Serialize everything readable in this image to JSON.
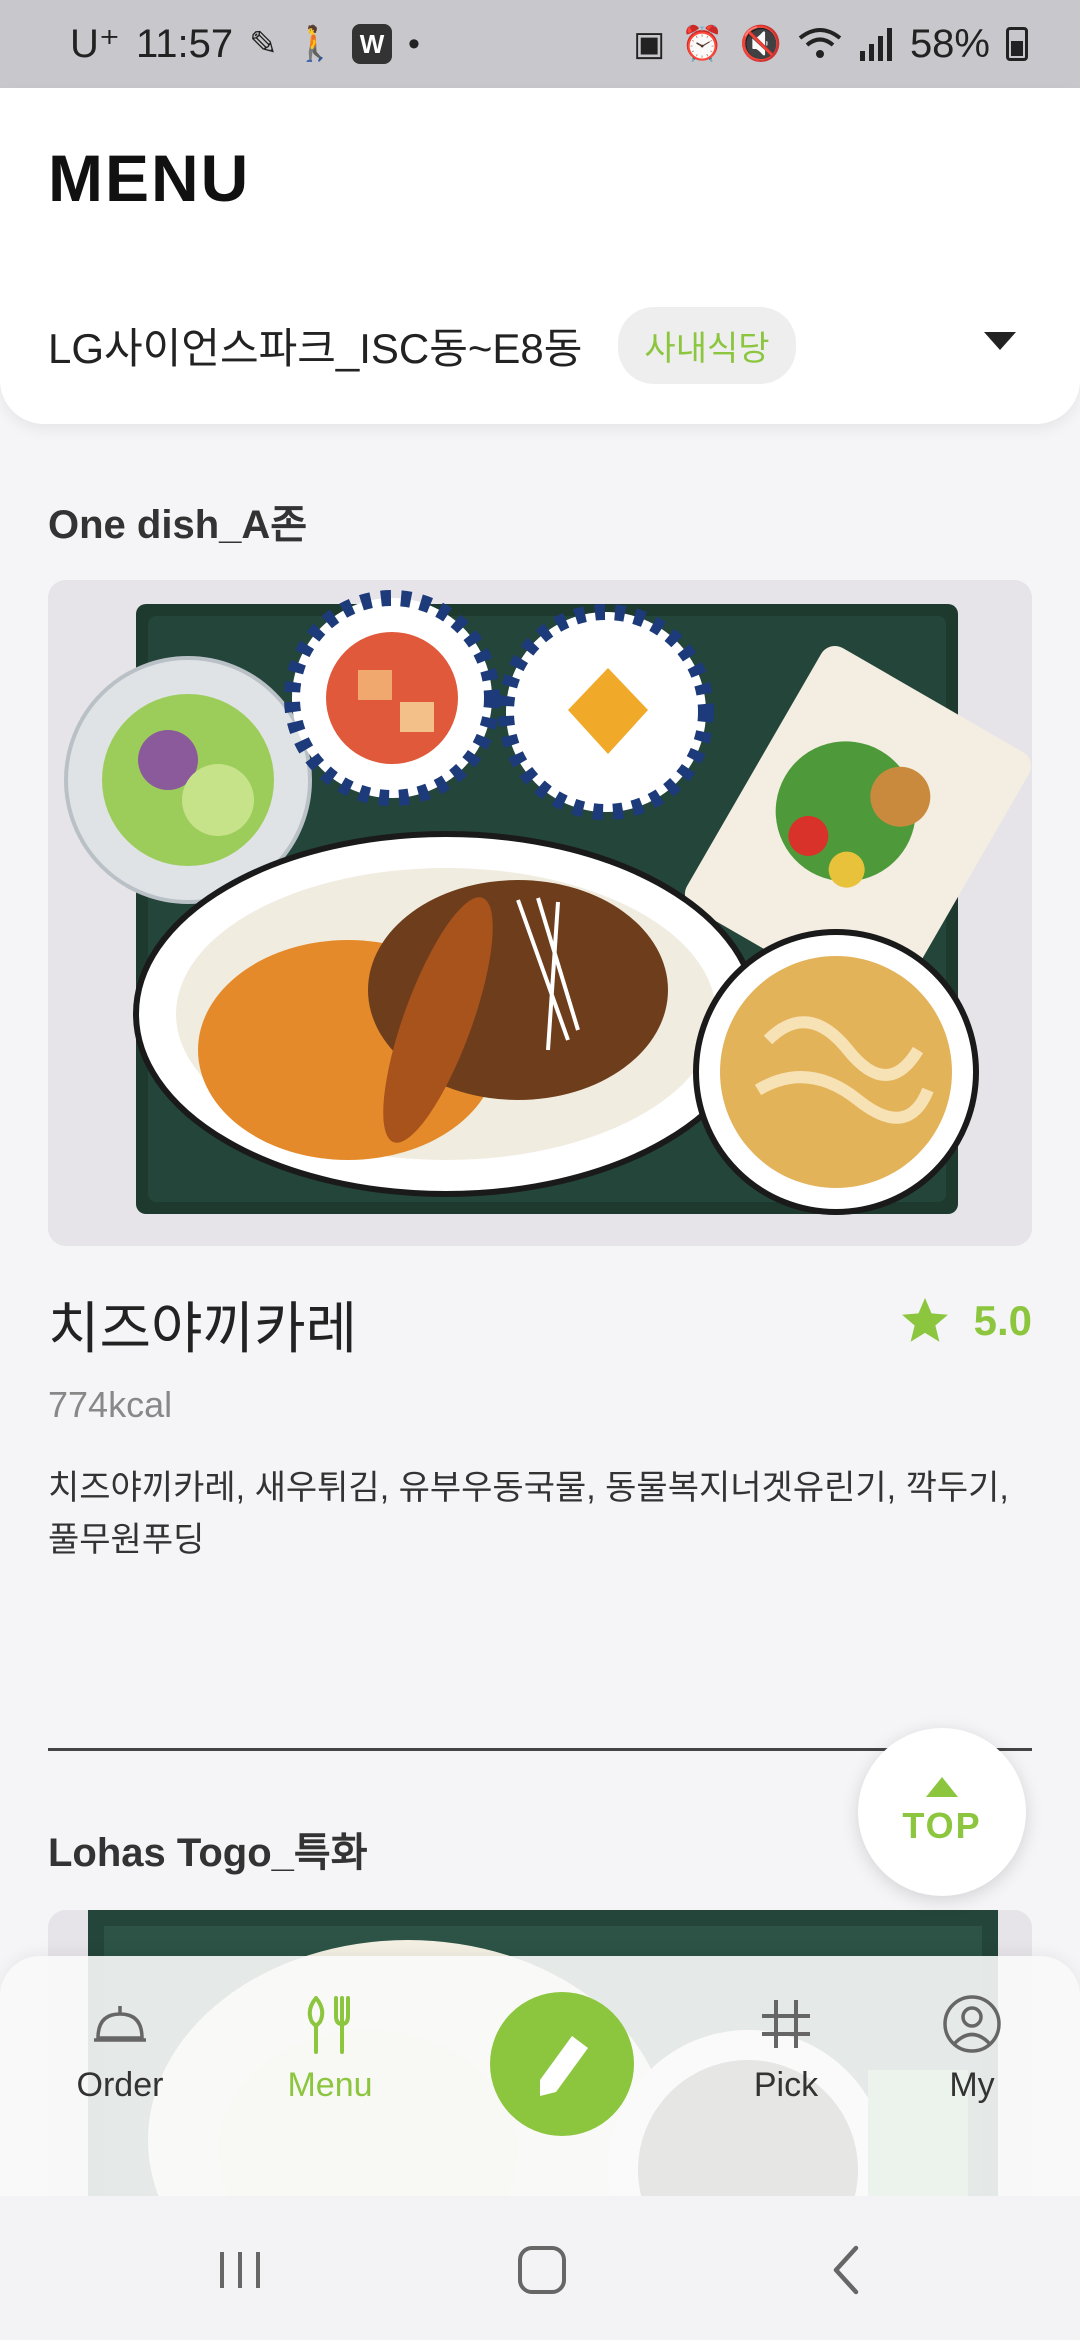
{
  "status_bar": {
    "carrier": "U⁺",
    "time": "11:57",
    "battery": "58%"
  },
  "header": {
    "title": "MENU",
    "location": "LG사이언스파크_ISC동~E8동",
    "badge": "사내식당"
  },
  "sections": [
    {
      "title": "One dish_A존",
      "menu_name": "치즈야끼카레",
      "rating": "5.0",
      "calories": "774kcal",
      "ingredients": "치즈야끼카레, 새우튀김, 유부우동국물, 동물복지너겟유린기, 깍두기, 풀무원푸딩"
    },
    {
      "title": "Lohas Togo_특화"
    }
  ],
  "top_button": {
    "label": "TOP"
  },
  "bottom_nav": {
    "items": [
      {
        "label": "Order",
        "icon": "cloche-icon",
        "active": false
      },
      {
        "label": "Menu",
        "icon": "utensils-icon",
        "active": true
      },
      {
        "label": "",
        "icon": "pencil-icon",
        "active": false
      },
      {
        "label": "Pick",
        "icon": "hashtag-icon",
        "active": false
      },
      {
        "label": "My",
        "icon": "user-circle-icon",
        "active": false
      }
    ]
  },
  "colors": {
    "accent": "#8cc63f",
    "text": "#222222",
    "muted": "#888888"
  }
}
